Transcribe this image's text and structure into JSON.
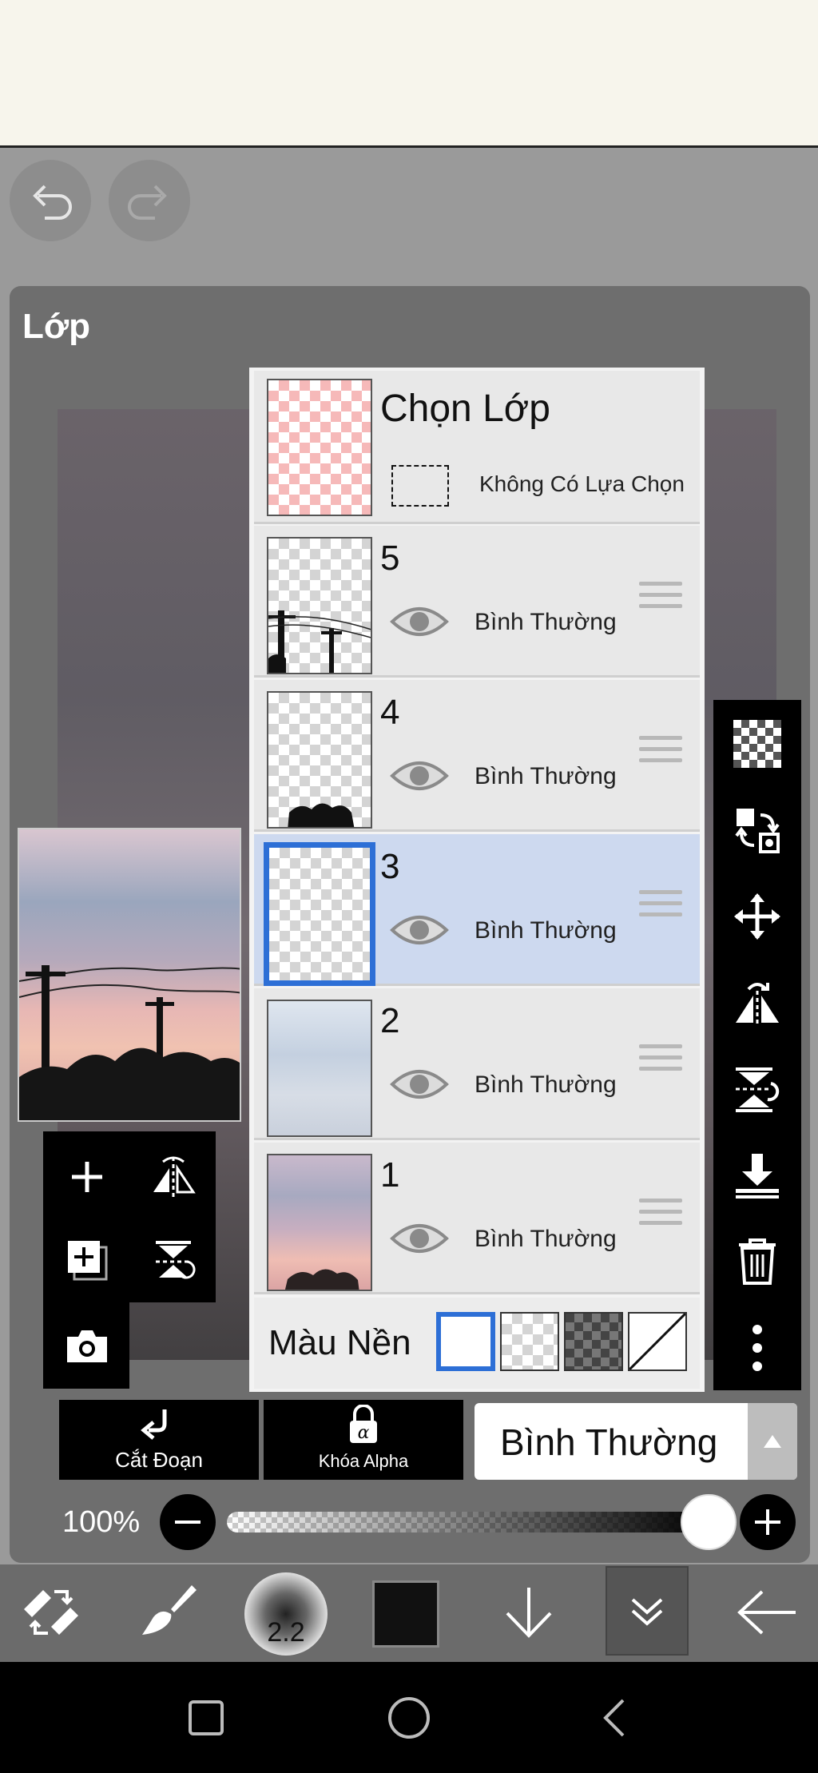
{
  "panel": {
    "title": "Lớp"
  },
  "selection_layer": {
    "title": "Chọn Lớp",
    "status": "Không Có Lựa Chọn"
  },
  "layers": [
    {
      "number": "5",
      "blend_mode": "Bình Thường",
      "visible": true,
      "selected": false
    },
    {
      "number": "4",
      "blend_mode": "Bình Thường",
      "visible": true,
      "selected": false
    },
    {
      "number": "3",
      "blend_mode": "Bình Thường",
      "visible": true,
      "selected": true
    },
    {
      "number": "2",
      "blend_mode": "Bình Thường",
      "visible": true,
      "selected": false
    },
    {
      "number": "1",
      "blend_mode": "Bình Thường",
      "visible": true,
      "selected": false
    }
  ],
  "background": {
    "label": "Màu Nền",
    "options": [
      "white",
      "transparent",
      "dark-checker",
      "none"
    ],
    "selected": "white"
  },
  "controls": {
    "clipping_label": "Cắt Đoạn",
    "alpha_lock_label": "Khóa Alpha",
    "blend_mode_value": "Bình Thường",
    "opacity_label": "100%",
    "opacity_value": 1.0
  },
  "toolbar": {
    "brush_size": "2.2"
  },
  "right_tools": [
    "checker-icon",
    "swap-layer-icon",
    "move-icon",
    "flip-horizontal-icon",
    "flip-vertical-icon",
    "merge-down-icon",
    "trash-icon",
    "more-vertical-icon"
  ],
  "left_tools": [
    "add-layer-icon",
    "flip-layer-icon",
    "duplicate-layer-icon",
    "merge-layer-icon",
    "camera-icon"
  ],
  "colors": {
    "accent": "#2d6fd6",
    "selected_row": "#cdd9ef",
    "panel_bg": "#6e6e6e",
    "toolbar_bg": "#000000",
    "foreground_color": "#111111"
  }
}
